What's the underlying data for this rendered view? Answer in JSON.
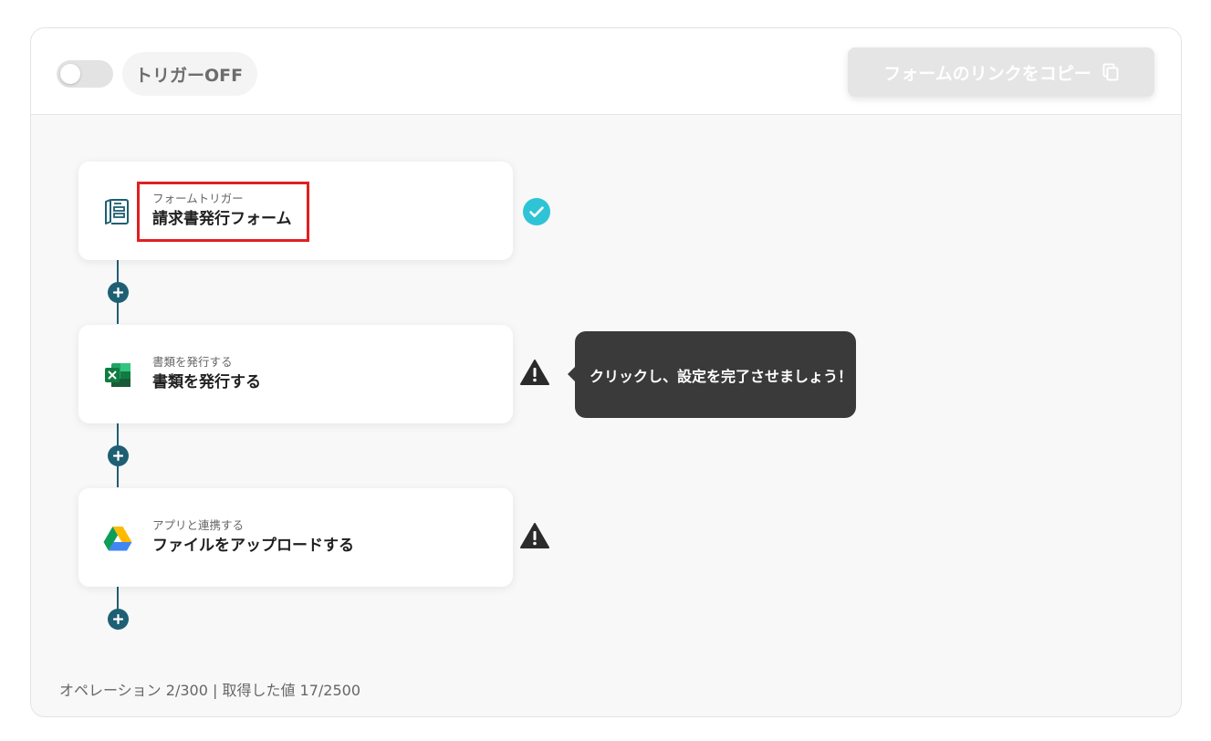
{
  "header": {
    "trigger_toggle_label": "トリガーOFF",
    "copy_link_button": "フォームのリンクをコピー"
  },
  "flow": {
    "steps": [
      {
        "subtitle": "フォームトリガー",
        "title": "請求書発行フォーム",
        "status": "complete",
        "icon": "form-icon"
      },
      {
        "subtitle": "書類を発行する",
        "title": "書類を発行する",
        "status": "warning",
        "icon": "excel-icon"
      },
      {
        "subtitle": "アプリと連携する",
        "title": "ファイルをアップロードする",
        "status": "warning",
        "icon": "google-drive-icon"
      }
    ],
    "tooltip": "クリックし、設定を完了させましょう！"
  },
  "footer": {
    "usage": "オペレーション 2/300 | 取得した値 17/2500"
  },
  "colors": {
    "connector": "#1e5f74",
    "complete": "#2ec4d6",
    "warning": "#2b2b2b",
    "highlight": "#e02020",
    "tooltip_bg": "#3a3a3a"
  }
}
